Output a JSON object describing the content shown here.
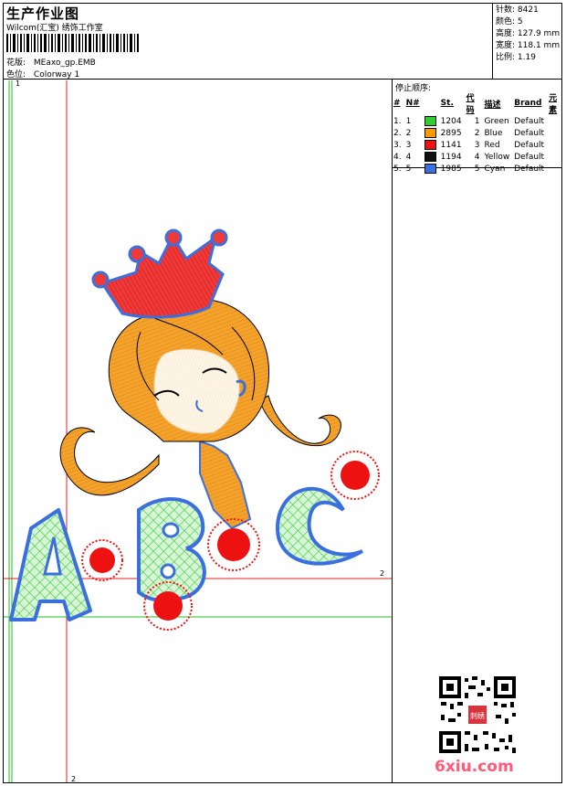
{
  "header": {
    "title": "生产作业图",
    "subtitle": "Wilcom(汇宝) 绣饰工作室",
    "design_label": "花版:",
    "design_value": "MEaxo_gp.EMB",
    "colorway_label": "色位:",
    "colorway_value": "Colorway 1"
  },
  "stats": [
    {
      "label": "针数:",
      "value": "8421"
    },
    {
      "label": "颜色:",
      "value": "5"
    },
    {
      "label": "高度:",
      "value": "127.9 mm"
    },
    {
      "label": "宽度:",
      "value": "118.1 mm"
    },
    {
      "label": "比例:",
      "value": "1.19"
    }
  ],
  "stop_sequence": {
    "heading": "停止顺序:",
    "columns": [
      "#",
      "N#",
      "St.",
      "代码",
      "描述",
      "Brand",
      "元素"
    ],
    "rows": [
      {
        "num": "1.",
        "n": "1",
        "color": "#33cc33",
        "st": "1204",
        "code": "1",
        "desc": "Green",
        "brand": "Default"
      },
      {
        "num": "2.",
        "n": "2",
        "color": "#ff9900",
        "st": "2895",
        "code": "2",
        "desc": "Blue",
        "brand": "Default"
      },
      {
        "num": "3.",
        "n": "3",
        "color": "#ee1111",
        "st": "1141",
        "code": "3",
        "desc": "Red",
        "brand": "Default"
      },
      {
        "num": "4.",
        "n": "4",
        "color": "#111111",
        "st": "1194",
        "code": "4",
        "desc": "Yellow",
        "brand": "Default"
      },
      {
        "num": "5.",
        "n": "5",
        "color": "#3b6fe0",
        "st": "1985",
        "code": "5",
        "desc": "Cyan",
        "brand": "Default"
      }
    ]
  },
  "guides": {
    "label_1": "1",
    "label_2a": "2",
    "label_2b": "2"
  },
  "design_text": {
    "a": "A",
    "b": "B",
    "c": "C"
  },
  "watermark": "6xiu.com",
  "qr_badge": "刺绣"
}
